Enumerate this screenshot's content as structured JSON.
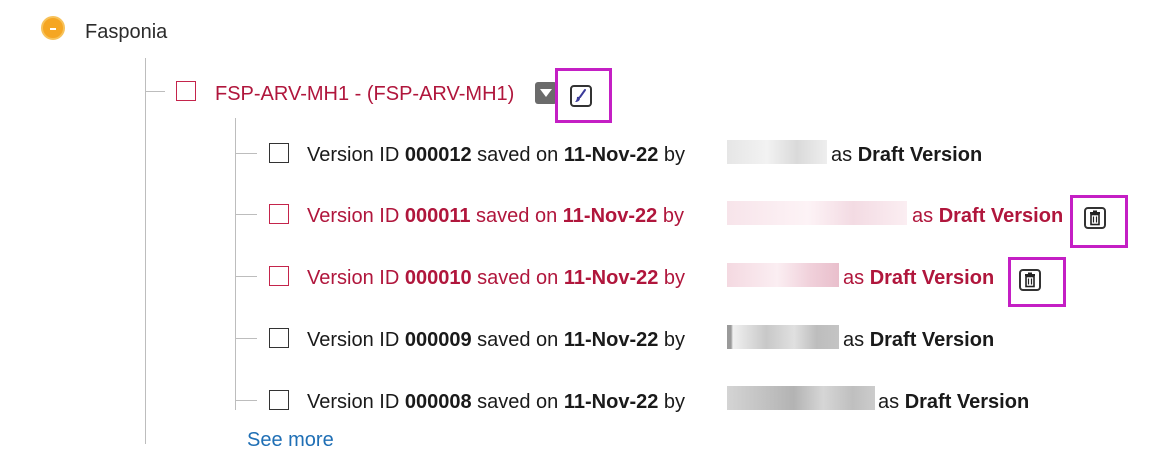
{
  "root": {
    "label": "Fasponia"
  },
  "node": {
    "label": "FSP-ARV-MH1 - (FSP-ARV-MH1)"
  },
  "versions": [
    {
      "prefix": "Version ID ",
      "id": "000012",
      "saved_on": " saved on ",
      "date": "11-Nov-22",
      "by": " by ",
      "as": " as ",
      "status": "Draft Version"
    },
    {
      "prefix": "Version ID ",
      "id": "000011",
      "saved_on": " saved on ",
      "date": "11-Nov-22",
      "by": " by ",
      "as": " as ",
      "status": "Draft Version"
    },
    {
      "prefix": "Version ID ",
      "id": "000010",
      "saved_on": " saved on ",
      "date": "11-Nov-22",
      "by": " by ",
      "as": " as ",
      "status": "Draft Version"
    },
    {
      "prefix": "Version ID ",
      "id": "000009",
      "saved_on": " saved on ",
      "date": "11-Nov-22",
      "by": " by ",
      "as": " as ",
      "status": "Draft Version"
    },
    {
      "prefix": "Version ID ",
      "id": "000008",
      "saved_on": " saved on ",
      "date": "11-Nov-22",
      "by": " by ",
      "as": " as ",
      "status": "Draft Version"
    }
  ],
  "see_more": "See more",
  "colors": {
    "accent_red": "#b0163c",
    "highlight": "#c41fc4",
    "dot": "#f5a623",
    "link": "#1f6fb5"
  },
  "icons": {
    "collapse": "minus-circle-icon",
    "dropdown": "caret-down-icon",
    "edit": "brush-icon",
    "delete": "trash-icon"
  }
}
